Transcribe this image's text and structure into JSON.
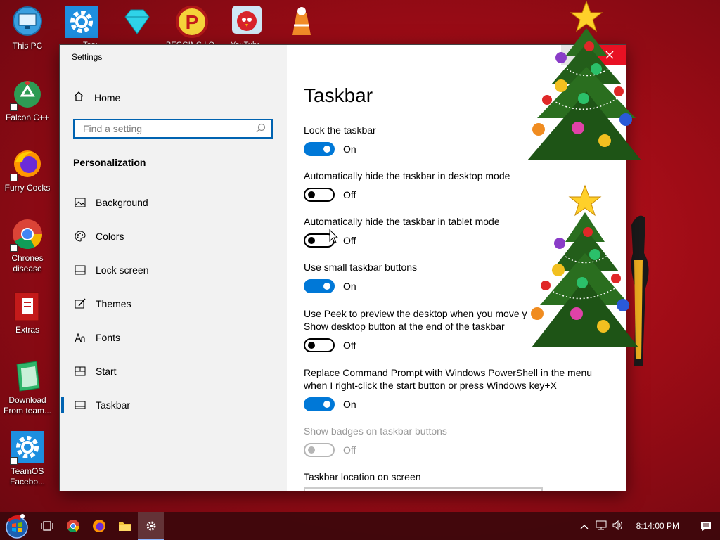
{
  "desktop": {
    "icons": [
      {
        "label": "This PC",
        "icon": "monitor-icon"
      },
      {
        "label": "Falcon C++",
        "icon": "recycle-bin-icon"
      },
      {
        "label": "Furry Cocks",
        "icon": "firefox-icon"
      },
      {
        "label": "Chrones disease",
        "icon": "chrome-icon"
      },
      {
        "label": "Extras",
        "icon": "folder-gift-icon"
      },
      {
        "label": "Download From team...",
        "icon": "notepad-icon"
      },
      {
        "label": "TeamOS Facebo...",
        "icon": "gear-icon"
      }
    ],
    "top_icons": [
      {
        "label": "TeamOS",
        "icon": "gear-icon"
      },
      {
        "label": "",
        "icon": "diamond-icon"
      },
      {
        "label": "BEGGING LOL",
        "icon": "p-badge-icon"
      },
      {
        "label": "YouTube",
        "icon": "angry-bird-icon"
      },
      {
        "label": "",
        "icon": "candle-icon"
      }
    ]
  },
  "window": {
    "title": "Settings",
    "home_label": "Home",
    "search_placeholder": "Find a setting",
    "section_header": "Personalization",
    "nav": [
      {
        "label": "Background",
        "icon": "image-icon",
        "active": false
      },
      {
        "label": "Colors",
        "icon": "palette-icon",
        "active": false
      },
      {
        "label": "Lock screen",
        "icon": "lock-screen-icon",
        "active": false
      },
      {
        "label": "Themes",
        "icon": "brush-icon",
        "active": false
      },
      {
        "label": "Fonts",
        "icon": "font-icon",
        "active": false
      },
      {
        "label": "Start",
        "icon": "start-icon",
        "active": false
      },
      {
        "label": "Taskbar",
        "icon": "taskbar-icon",
        "active": true
      }
    ],
    "page_title": "Taskbar",
    "settings": [
      {
        "label": "Lock the taskbar",
        "state": "On",
        "on": true,
        "disabled": false
      },
      {
        "label": "Automatically hide the taskbar in desktop mode",
        "state": "Off",
        "on": false,
        "disabled": false
      },
      {
        "label": "Automatically hide the taskbar in tablet mode",
        "state": "Off",
        "on": false,
        "disabled": false
      },
      {
        "label": "Use small taskbar buttons",
        "state": "On",
        "on": true,
        "disabled": false
      },
      {
        "label_line1": "Use Peek to preview the desktop when you move y",
        "label_line2": "Show desktop button at the end of the taskbar",
        "state": "Off",
        "on": false,
        "disabled": false
      },
      {
        "label_line1": "Replace Command Prompt with Windows PowerShell in the menu",
        "label_line2": "when I right-click the start button or press Windows key+X",
        "state": "On",
        "on": true,
        "disabled": false
      },
      {
        "label": "Show badges on taskbar buttons",
        "state": "Off",
        "on": false,
        "disabled": true
      }
    ],
    "location_label": "Taskbar location on screen"
  },
  "taskbar": {
    "time": "8:14:00 PM",
    "buttons": [
      "start-orb-icon",
      "task-view-icon",
      "chrome-icon",
      "firefox-icon",
      "file-explorer-icon",
      "settings-gear-icon"
    ],
    "tray": [
      "chevron-up-icon",
      "network-icon",
      "volume-icon",
      "action-center-icon"
    ]
  },
  "colors": {
    "accent": "#0078d7",
    "desktop_red": "#b0101a"
  }
}
